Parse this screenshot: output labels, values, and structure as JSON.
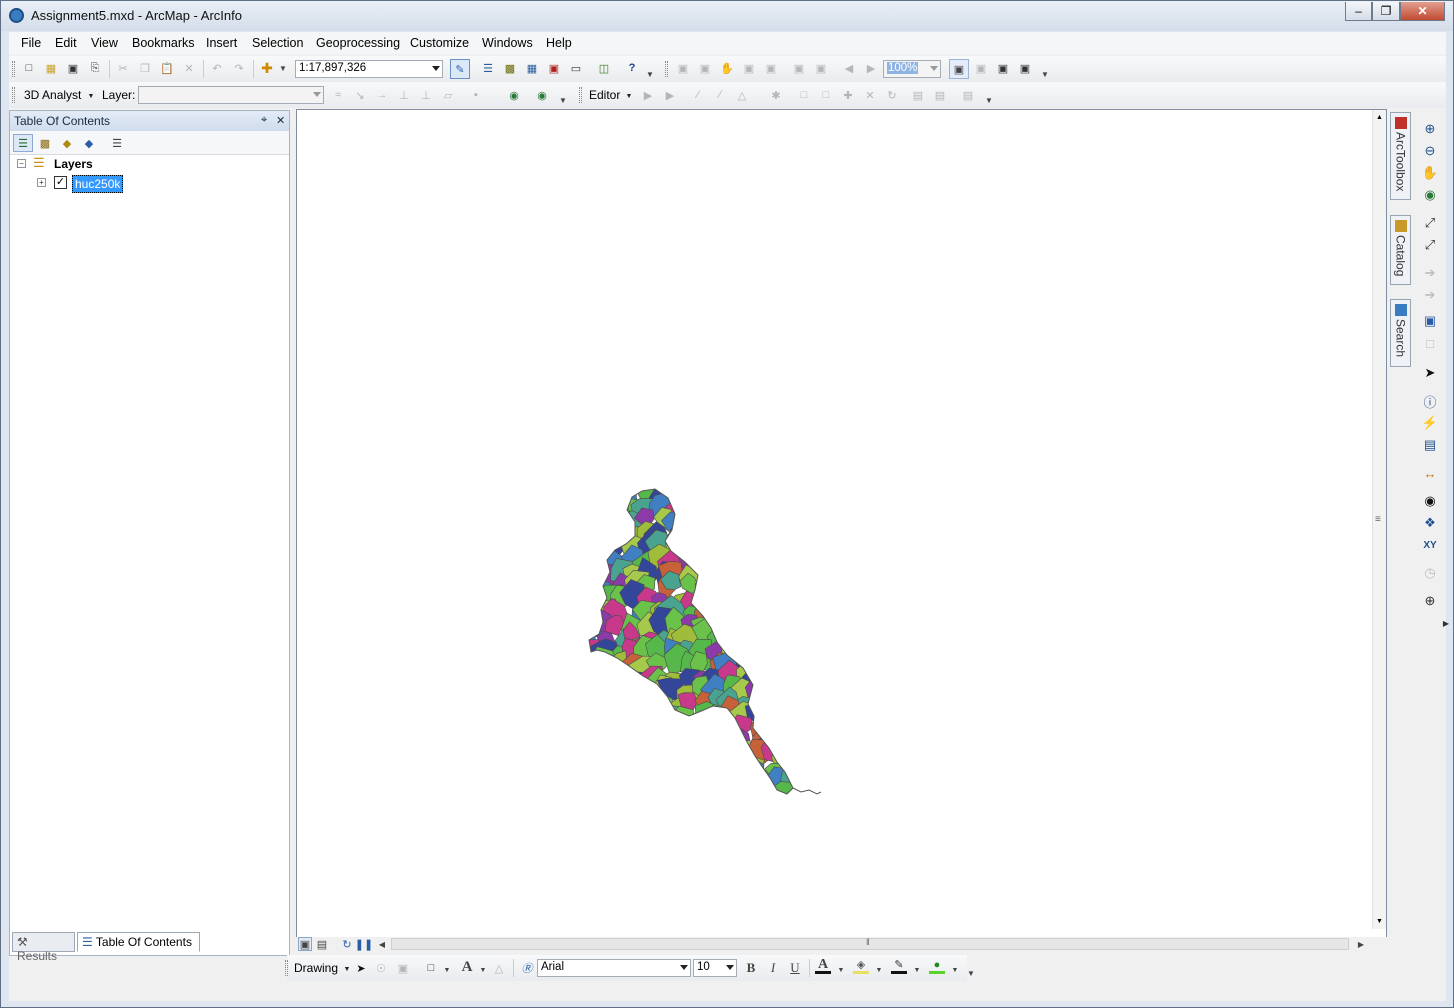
{
  "window": {
    "title": "Assignment5.mxd - ArcMap - ArcInfo",
    "minimize": "–",
    "maximize": "❐",
    "close": "✕"
  },
  "menu": [
    "File",
    "Edit",
    "View",
    "Bookmarks",
    "Insert",
    "Selection",
    "Geoprocessing",
    "Customize",
    "Windows",
    "Help"
  ],
  "standard_toolbar": {
    "scale": "1:17,897,326",
    "zoom_percent": "100%"
  },
  "analyst_toolbar": {
    "analyst_label": "3D Analyst",
    "layer_label": "Layer:",
    "layer_value": "",
    "editor_label": "Editor"
  },
  "toc": {
    "title": "Table Of Contents",
    "pin": "⌖",
    "close": "✕",
    "root_label": "Layers",
    "layer_label": "huc250k",
    "layer_checked": true,
    "expand_root": "−",
    "expand_layer": "+"
  },
  "bottom_tabs": {
    "results": "Results",
    "toc": "Table Of Contents"
  },
  "dock_tabs": [
    "ArcToolbox",
    "Catalog",
    "Search"
  ],
  "draw_toolbar": {
    "drawing_label": "Drawing",
    "font_name": "Arial",
    "font_size": "10",
    "bold": "B",
    "italic": "I",
    "underline": "U",
    "text_tool": "A"
  },
  "map": {
    "colors": [
      "#8b3aa8",
      "#3f7fc2",
      "#56b84a",
      "#c8398c",
      "#4aa38f",
      "#9fbd3a",
      "#c7613a",
      "#34469a",
      "#6ac24a",
      "#a7c94b"
    ]
  }
}
